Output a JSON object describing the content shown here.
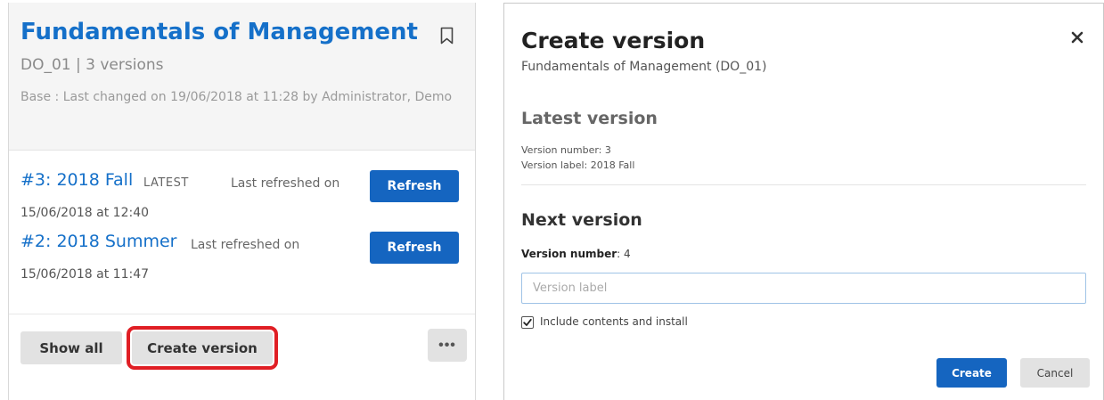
{
  "course_card": {
    "title": "Fundamentals of Management",
    "subtitle": "DO_01  | 3 versions",
    "base_info": "Base : Last changed on 19/06/2018 at 11:28 by Administrator, Demo",
    "versions": [
      {
        "name": "#3: 2018 Fall",
        "tag": "LATEST",
        "refreshed_label": "Last refreshed on",
        "refreshed_date": "15/06/2018 at 12:40",
        "button": "Refresh"
      },
      {
        "name": "#2: 2018 Summer",
        "refreshed_label": "Last refreshed on",
        "refreshed_date": "15/06/2018 at 11:47",
        "button": "Refresh"
      }
    ],
    "show_all": "Show all",
    "create_version": "Create version",
    "more": "•••"
  },
  "dialog": {
    "title": "Create version",
    "subtitle": "Fundamentals of Management (DO_01)",
    "latest_heading": "Latest version",
    "latest_number": "Version number: 3",
    "latest_label": "Version label: 2018 Fall",
    "next_heading": "Next version",
    "next_number_label": "Version number",
    "next_number_value": ": 4",
    "label_placeholder": "Version label",
    "include_label": "Include contents and install",
    "include_checked": true,
    "create_button": "Create",
    "cancel_button": "Cancel"
  },
  "colors": {
    "accent": "#1565c0",
    "link": "#1570c9",
    "highlight": "#e01e24"
  },
  "icons": [
    "bookmark-icon",
    "close-icon",
    "checkmark-icon",
    "more-icon"
  ]
}
